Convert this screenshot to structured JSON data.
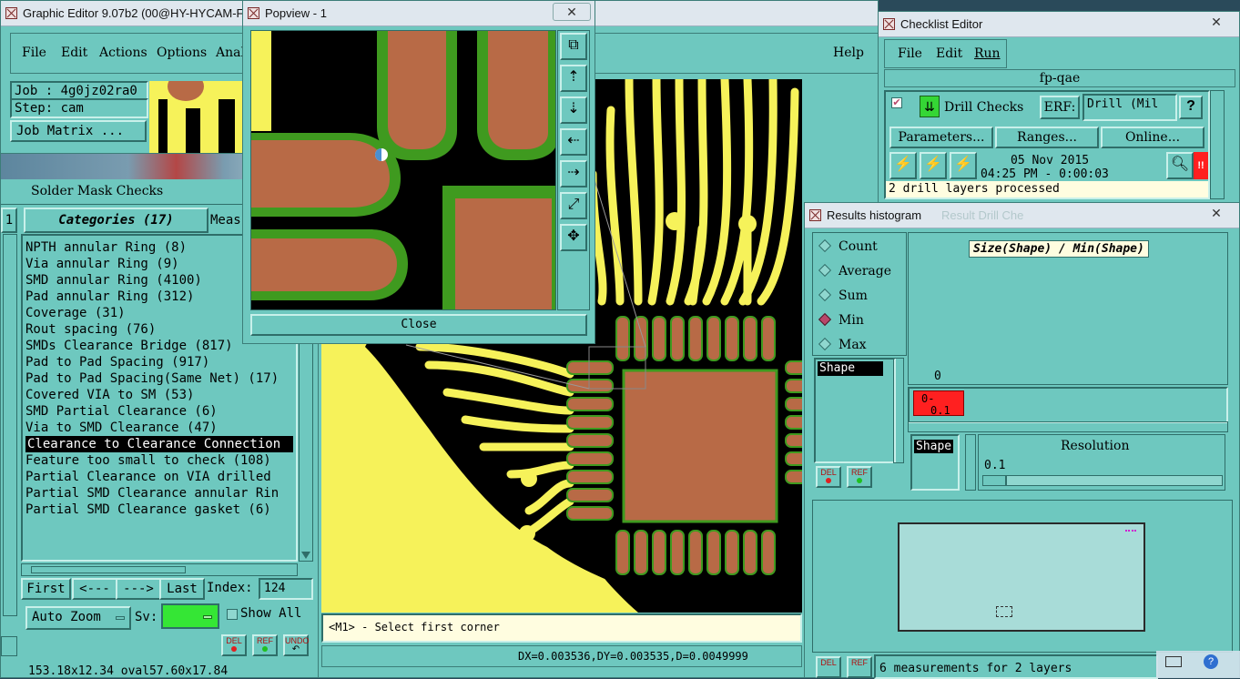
{
  "graphic_editor": {
    "title": "Graphic Editor 9.07b2 (00@HY-HYCAM-F",
    "menu": [
      "File",
      "Edit",
      "Actions",
      "Options",
      "Anal"
    ],
    "help": "Help",
    "job": "Job : 4g0jz02ra0",
    "step": "Step: cam",
    "job_matrix": "Job Matrix ...",
    "status_prompt": "<M1> - Select first corner",
    "coords": "DX=0.003536,DY=0.003535,D=0.0049999"
  },
  "solder_mask": {
    "title": "Solder Mask Checks",
    "categories_tab": "Categories (17)",
    "meas_tab": "Meas",
    "left_stub": "1",
    "items": [
      "NPTH annular Ring (8)",
      "Via annular Ring (9)",
      "SMD annular Ring (4100)",
      "Pad annular Ring (312)",
      "Coverage (31)",
      "Rout spacing (76)",
      "SMDs Clearance Bridge (817)",
      "Pad to Pad Spacing (917)",
      "Pad to Pad Spacing(Same Net) (17)",
      "Covered VIA to SM (53)",
      "SMD Partial Clearance (6)",
      "Via to SMD Clearance (47)",
      "Clearance to Clearance Connection",
      "Feature too small to check (108)",
      "Partial Clearance on VIA drilled",
      "Partial SMD Clearance annular Rin",
      "Partial SMD Clearance gasket (6)"
    ],
    "selected_index": 12,
    "nav": {
      "first": "First",
      "prev": "<---",
      "next": "--->",
      "last": "Last",
      "index_label": "Index:",
      "index_value": "124"
    },
    "auto_zoom": "Auto Zoom",
    "sv_label": "Sv:",
    "show_all": "Show All",
    "bottom_text": "153.18x12.34 oval57.60x17.84",
    "icons": {
      "del": "DEL",
      "ref": "REF",
      "undo": "UNDO"
    }
  },
  "popview": {
    "title": "Popview - 1",
    "close": "Close"
  },
  "checklist": {
    "title": "Checklist Editor",
    "menu": [
      "File",
      "Edit",
      "Run"
    ],
    "name": "fp-qae",
    "check_name": "Drill Checks",
    "erf_label": "ERF:",
    "erf_value": "Drill (Mil",
    "help": "?",
    "parameters": "Parameters...",
    "ranges": "Ranges...",
    "online": "Online...",
    "date": "05 Nov 2015",
    "time": "04:25 PM - 0:00:03",
    "alert": "!!",
    "status": "2 drill layers processed"
  },
  "histogram": {
    "title": "Results histogram",
    "ghost_title": "Result Drill Che",
    "radios": [
      "Count",
      "Average",
      "Sum",
      "Min",
      "Max"
    ],
    "selected_radio": 3,
    "shape_list_item": "Shape",
    "chart_title": "Size(Shape) / Min(Shape)",
    "axis_zero": "0",
    "bar_label_top": "0-",
    "bar_label_bottom": "0.1",
    "shape_label": "Shape",
    "resolution_label": "Resolution",
    "resolution_value": "0.1",
    "footer": "6 measurements for 2 layers",
    "icons": {
      "del": "DEL",
      "ref": "REF"
    }
  },
  "colors": {
    "panel": "#6ec8bf",
    "board_yellow": "#f6f25a",
    "copper": "#b86a46",
    "mask_green": "#3f9a1f",
    "selected_red": "#ff2020"
  }
}
